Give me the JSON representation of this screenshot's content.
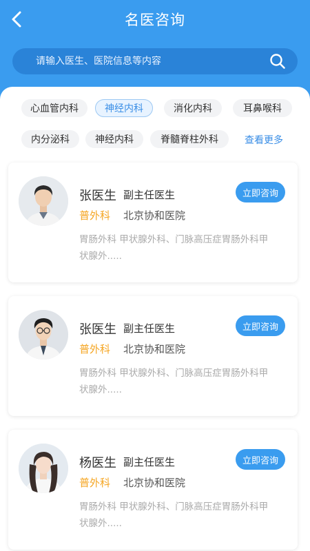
{
  "header": {
    "title": "名医咨询",
    "back_icon": "chevron-left-icon"
  },
  "search": {
    "placeholder": "请输入医生、医院信息等内容",
    "icon": "search-icon"
  },
  "departments": {
    "row1": [
      "心血管内科",
      "神经内科",
      "消化内科",
      "耳鼻喉科"
    ],
    "row2": [
      "内分泌科",
      "神经内科",
      "脊髓脊柱外科"
    ],
    "selected": "神经内科",
    "more_label": "查看更多"
  },
  "doctors": [
    {
      "name": "张医生",
      "title": "副主任医生",
      "department": "普外科",
      "hospital": "北京协和医院",
      "desc_line1": "胃肠外科  甲状腺外科、门脉高压症胃肠外科甲",
      "desc_line2": "状腺外.....",
      "consult_label": "立即咨询"
    },
    {
      "name": "张医生",
      "title": "副主任医生",
      "department": "普外科",
      "hospital": "北京协和医院",
      "desc_line1": "胃肠外科  甲状腺外科、门脉高压症胃肠外科甲",
      "desc_line2": "状腺外.....",
      "consult_label": "立即咨询"
    },
    {
      "name": "杨医生",
      "title": "副主任医生",
      "department": "普外科",
      "hospital": "北京协和医院",
      "desc_line1": "胃肠外科  甲状腺外科、门脉高压症胃肠外科甲",
      "desc_line2": "状腺外.....",
      "consult_label": "立即咨询"
    }
  ],
  "colors": {
    "primary": "#3a9cef",
    "accent": "#f5a623",
    "search_bg": "#2a83d8"
  }
}
